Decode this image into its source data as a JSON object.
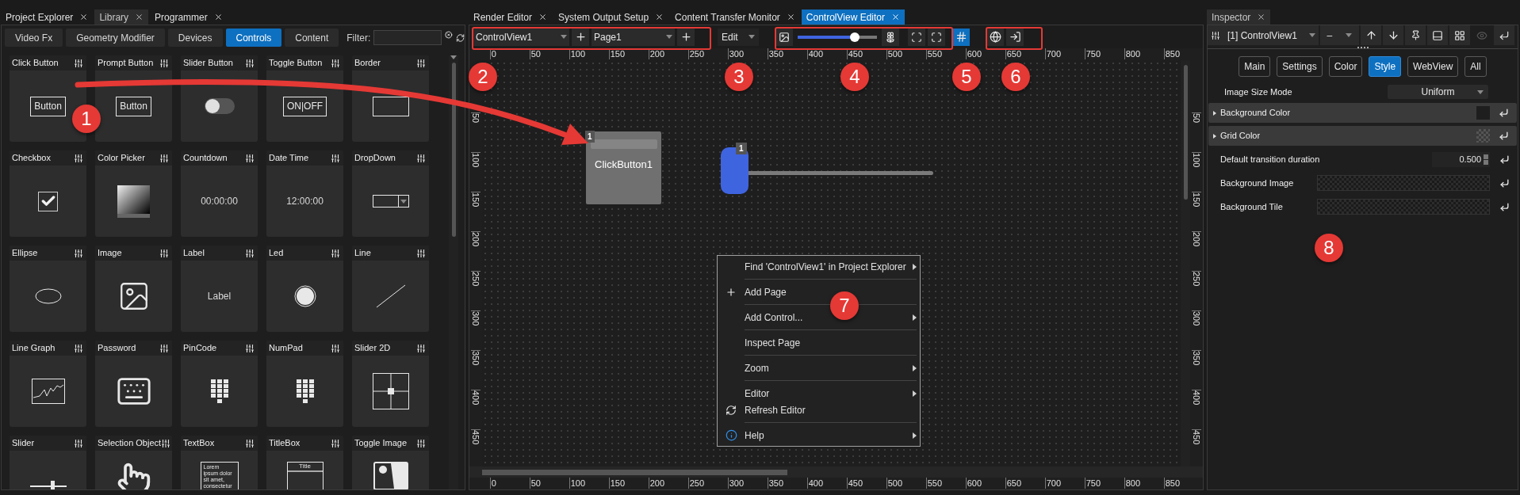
{
  "library": {
    "tabs": [
      {
        "label": "Project Explorer",
        "selected": false
      },
      {
        "label": "Library",
        "selected": true
      },
      {
        "label": "Programmer",
        "selected": false
      }
    ],
    "categories": [
      {
        "label": "Video Fx",
        "selected": false
      },
      {
        "label": "Geometry Modifier",
        "selected": false
      },
      {
        "label": "Devices",
        "selected": false
      },
      {
        "label": "Controls",
        "selected": true
      },
      {
        "label": "Content",
        "selected": false
      }
    ],
    "filter": {
      "label": "Filter:"
    },
    "controls": [
      {
        "name": "Click Button",
        "kind": "button",
        "preview_text": "Button"
      },
      {
        "name": "Prompt Button",
        "kind": "button",
        "preview_text": "Button"
      },
      {
        "name": "Slider Button",
        "kind": "switch"
      },
      {
        "name": "Toggle Button",
        "kind": "button",
        "preview_text": "ON|OFF"
      },
      {
        "name": "Border",
        "kind": "border"
      },
      {
        "name": "Checkbox",
        "kind": "checkbox"
      },
      {
        "name": "Color Picker",
        "kind": "gradient"
      },
      {
        "name": "Countdown",
        "kind": "text",
        "preview_text": "00:00:00"
      },
      {
        "name": "Date Time",
        "kind": "text",
        "preview_text": "12:00:00"
      },
      {
        "name": "DropDown",
        "kind": "dropdown"
      },
      {
        "name": "Ellipse",
        "kind": "ellipse"
      },
      {
        "name": "Image",
        "kind": "image"
      },
      {
        "name": "Label",
        "kind": "text",
        "preview_text": "Label"
      },
      {
        "name": "Led",
        "kind": "led"
      },
      {
        "name": "Line",
        "kind": "line"
      },
      {
        "name": "Line Graph",
        "kind": "graph"
      },
      {
        "name": "Password",
        "kind": "keyboard"
      },
      {
        "name": "PinCode",
        "kind": "keypad"
      },
      {
        "name": "NumPad",
        "kind": "keypad"
      },
      {
        "name": "Slider 2D",
        "kind": "crosshair"
      },
      {
        "name": "Slider",
        "kind": "slider"
      },
      {
        "name": "Selection Object",
        "kind": "hand"
      },
      {
        "name": "TextBox",
        "kind": "textbox",
        "preview_text": "Lorem ipsum dolor sit amet, consectetur"
      },
      {
        "name": "TitleBox",
        "kind": "titlebox",
        "preview_text": "Title"
      },
      {
        "name": "Toggle Image",
        "kind": "toggle-image"
      }
    ]
  },
  "editor": {
    "tabs": [
      {
        "label": "Render Editor",
        "selected": false
      },
      {
        "label": "System Output Setup",
        "selected": false
      },
      {
        "label": "Content Transfer Monitor",
        "selected": false
      },
      {
        "label": "ControlView Editor",
        "selected": true
      }
    ],
    "view_select": {
      "value": "ControlView1"
    },
    "page_select": {
      "value": "Page1"
    },
    "mode_select": {
      "value": "Edit"
    },
    "zoom": {
      "level": 0.72
    },
    "grid_toggle": {
      "on": true
    },
    "top_ruler": [
      "0",
      "50",
      "100",
      "150",
      "200",
      "250",
      "300",
      "350",
      "400",
      "450",
      "500",
      "550",
      "600",
      "650",
      "700",
      "750",
      "800",
      "850"
    ],
    "left_ruler": [
      "50",
      "100",
      "150",
      "200",
      "250",
      "300",
      "350",
      "400",
      "450"
    ],
    "right_ruler": [
      "50",
      "100",
      "150",
      "200",
      "250",
      "300",
      "350",
      "400",
      "450"
    ],
    "bottom_ruler": [
      "0",
      "50",
      "100",
      "150",
      "200",
      "250",
      "300",
      "350",
      "400",
      "450",
      "500",
      "550",
      "600",
      "650",
      "700",
      "750",
      "800",
      "850"
    ],
    "canvas_objects": [
      {
        "kind": "button",
        "label": "ClickButton1",
        "badge": "1"
      },
      {
        "kind": "slider",
        "badge": "1"
      }
    ],
    "context_menu": [
      {
        "label": "Find 'ControlView1' in Project Explorer",
        "kind": "plain",
        "submenu": true,
        "separator_before": false
      },
      {
        "label": "Add Page",
        "kind": "add",
        "submenu": false,
        "separator_before": true
      },
      {
        "label": "Add Control...",
        "kind": "plain",
        "submenu": true,
        "separator_before": true
      },
      {
        "label": "Inspect Page",
        "kind": "plain",
        "submenu": false,
        "separator_before": true
      },
      {
        "label": "Zoom",
        "kind": "plain",
        "submenu": true,
        "separator_before": true
      },
      {
        "label": "Editor",
        "kind": "plain",
        "submenu": true,
        "separator_before": true
      },
      {
        "label": "Refresh Editor",
        "kind": "refresh",
        "submenu": false,
        "separator_before": false
      },
      {
        "label": "Help",
        "kind": "help",
        "submenu": true,
        "separator_before": true
      }
    ]
  },
  "inspector": {
    "tab": {
      "label": "Inspector"
    },
    "object_select": {
      "value": "[1] ControlView1"
    },
    "secondary_select": {
      "value": "–"
    },
    "tabs": [
      {
        "label": "Main",
        "selected": false
      },
      {
        "label": "Settings",
        "selected": false
      },
      {
        "label": "Color",
        "selected": false
      },
      {
        "label": "Style",
        "selected": true
      },
      {
        "label": "WebView",
        "selected": false
      },
      {
        "label": "All",
        "selected": false
      }
    ],
    "properties": [
      {
        "kind": "select",
        "label": "Image Size Mode",
        "value": "Uniform"
      },
      {
        "kind": "color",
        "label": "Background Color",
        "expanded": false,
        "transparent": false
      },
      {
        "kind": "color",
        "label": "Grid Color",
        "expanded": false,
        "transparent": true
      },
      {
        "kind": "number",
        "label": "Default transition duration",
        "value": "0.500"
      },
      {
        "kind": "image",
        "label": "Background Image"
      },
      {
        "kind": "image",
        "label": "Background Tile"
      }
    ]
  },
  "callouts": [
    {
      "label": "1"
    },
    {
      "label": "2"
    },
    {
      "label": "3"
    },
    {
      "label": "4"
    },
    {
      "label": "5"
    },
    {
      "label": "6"
    },
    {
      "label": "7"
    },
    {
      "label": "8"
    }
  ]
}
